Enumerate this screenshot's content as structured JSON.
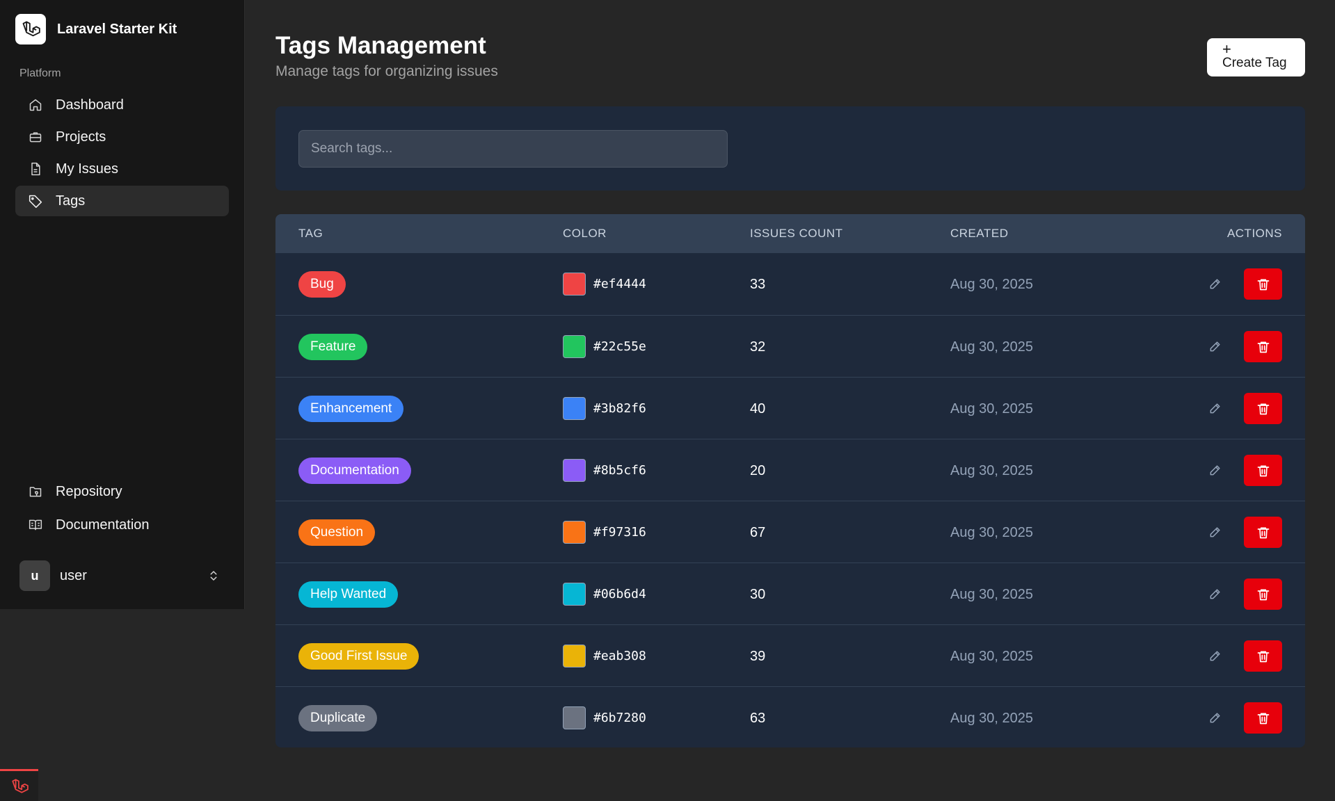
{
  "app": {
    "name": "Laravel Starter Kit"
  },
  "sidebar": {
    "group_label": "Platform",
    "items": [
      {
        "label": "Dashboard",
        "icon": "home-icon",
        "active": false
      },
      {
        "label": "Projects",
        "icon": "briefcase-icon",
        "active": false
      },
      {
        "label": "My Issues",
        "icon": "file-icon",
        "active": false
      },
      {
        "label": "Tags",
        "icon": "tag-icon",
        "active": true
      }
    ],
    "footer_items": [
      {
        "label": "Repository",
        "icon": "folder-git-icon"
      },
      {
        "label": "Documentation",
        "icon": "book-open-icon"
      }
    ],
    "user": {
      "initial": "u",
      "name": "user"
    }
  },
  "header": {
    "title": "Tags Management",
    "subtitle": "Manage tags for organizing issues",
    "create_label": "Create Tag"
  },
  "search": {
    "placeholder": "Search tags..."
  },
  "table": {
    "columns": [
      "TAG",
      "COLOR",
      "ISSUES COUNT",
      "CREATED",
      "ACTIONS"
    ],
    "rows": [
      {
        "tag": "Bug",
        "color": "#ef4444",
        "count": "33",
        "created": "Aug 30, 2025"
      },
      {
        "tag": "Feature",
        "color": "#22c55e",
        "count": "32",
        "created": "Aug 30, 2025"
      },
      {
        "tag": "Enhancement",
        "color": "#3b82f6",
        "count": "40",
        "created": "Aug 30, 2025"
      },
      {
        "tag": "Documentation",
        "color": "#8b5cf6",
        "count": "20",
        "created": "Aug 30, 2025"
      },
      {
        "tag": "Question",
        "color": "#f97316",
        "count": "67",
        "created": "Aug 30, 2025"
      },
      {
        "tag": "Help Wanted",
        "color": "#06b6d4",
        "count": "30",
        "created": "Aug 30, 2025"
      },
      {
        "tag": "Good First Issue",
        "color": "#eab308",
        "count": "39",
        "created": "Aug 30, 2025"
      },
      {
        "tag": "Duplicate",
        "color": "#6b7280",
        "count": "63",
        "created": "Aug 30, 2025"
      }
    ]
  },
  "colors": {
    "delete": "#e7000b",
    "card": "#1e293b",
    "table_header": "#334155"
  }
}
